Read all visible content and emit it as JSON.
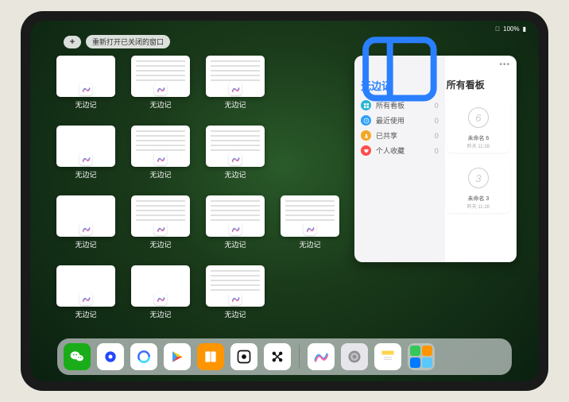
{
  "status_bar": {
    "wifi": "􀙇",
    "battery_text": "100%"
  },
  "toolbar": {
    "plus_label": "+",
    "reopen_label": "重新打开已关闭的窗口"
  },
  "grid": {
    "app_label": "无边记",
    "windows": [
      {
        "variant": "blank"
      },
      {
        "variant": "detail"
      },
      {
        "variant": "detail"
      },
      {
        "variant": "blank"
      },
      {
        "variant": "detail"
      },
      {
        "variant": "detail"
      },
      {
        "variant": "blank"
      },
      {
        "variant": "detail"
      },
      {
        "variant": "detail"
      },
      {
        "variant": "detail"
      },
      {
        "variant": "blank"
      },
      {
        "variant": "blank"
      },
      {
        "variant": "detail"
      }
    ],
    "layout": [
      0,
      1,
      2,
      3,
      4,
      5,
      6,
      7,
      8,
      9,
      10,
      11,
      12
    ]
  },
  "panel": {
    "title": "无边记",
    "rows": [
      {
        "icon": "grid",
        "color": "#2ab6d6",
        "label": "所有看板",
        "count": "0"
      },
      {
        "icon": "clock",
        "color": "#2a9fff",
        "label": "最近使用",
        "count": "0"
      },
      {
        "icon": "people",
        "color": "#f5a623",
        "label": "已共享",
        "count": "0"
      },
      {
        "icon": "heart",
        "color": "#ff4d4d",
        "label": "个人收藏",
        "count": "0"
      }
    ],
    "right_title": "所有看板",
    "boards": [
      {
        "glyph": "6",
        "name": "未命名 6",
        "time": "昨天 11:28"
      },
      {
        "glyph": "3",
        "name": "未命名 3",
        "time": "昨天 11:28"
      }
    ]
  },
  "dock": {
    "apps": [
      {
        "name": "wechat",
        "bg": "#1aad19"
      },
      {
        "name": "browser",
        "bg": "#ffffff"
      },
      {
        "name": "quark",
        "bg": "#ffffff"
      },
      {
        "name": "play",
        "bg": "#ffffff"
      },
      {
        "name": "books",
        "bg": "#ff9500"
      },
      {
        "name": "widgets",
        "bg": "#ffffff"
      },
      {
        "name": "connect",
        "bg": "#ffffff"
      },
      {
        "name": "freeform",
        "bg": "#ffffff"
      },
      {
        "name": "settings",
        "bg": "#e5e5ea"
      },
      {
        "name": "notes",
        "bg": "#ffffff"
      }
    ]
  }
}
